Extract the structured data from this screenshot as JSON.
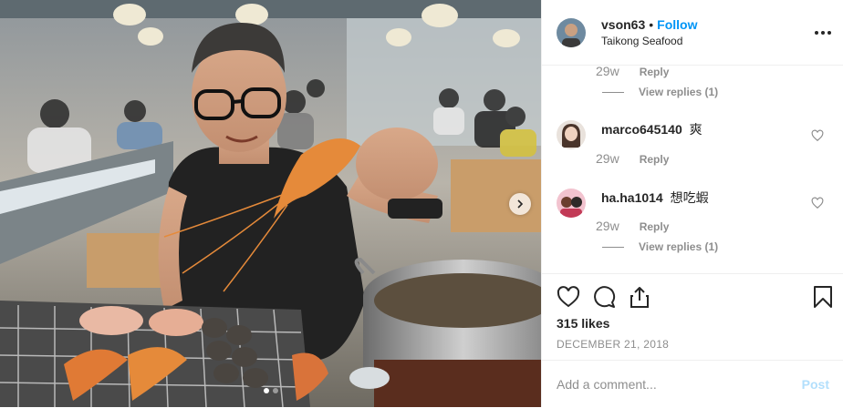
{
  "post": {
    "author": {
      "username": "vson63",
      "separator": "•",
      "follow_label": "Follow",
      "location": "Taikong Seafood"
    },
    "photo": {
      "carousel_count": 2,
      "active_index": 0
    },
    "comments": [
      {
        "username": "",
        "text": "",
        "time": "29w",
        "reply_label": "Reply",
        "view_replies": "View replies (1)"
      },
      {
        "username": "marco645140",
        "text": "爽",
        "time": "29w",
        "reply_label": "Reply",
        "view_replies": ""
      },
      {
        "username": "ha.ha1014",
        "text": "想吃蝦",
        "time": "29w",
        "reply_label": "Reply",
        "view_replies": "View replies (1)"
      }
    ],
    "likes": "315 likes",
    "date": "DECEMBER 21, 2018",
    "add_comment": {
      "placeholder": "Add a comment...",
      "post_label": "Post"
    },
    "icons": {
      "like": "heart-icon",
      "comment": "comment-icon",
      "share": "share-icon",
      "save": "bookmark-icon",
      "more": "more-options-icon",
      "next": "chevron-right-icon"
    },
    "colors": {
      "link": "#0095f6",
      "post_disabled": "#b2dffc",
      "secondary_text": "#8e8e8e"
    }
  }
}
